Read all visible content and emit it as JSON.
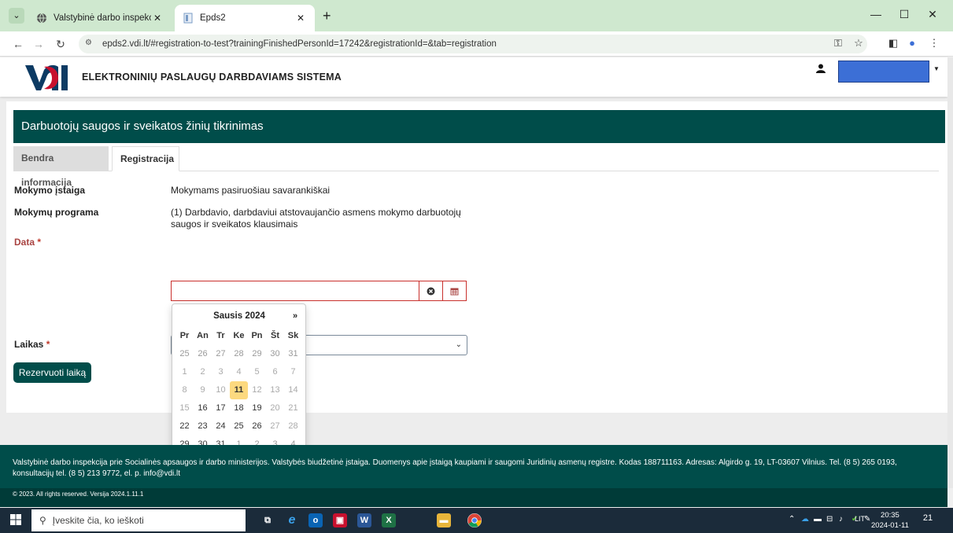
{
  "browser": {
    "tabs": [
      {
        "title": "Valstybinė darbo inspekcija",
        "active": false
      },
      {
        "title": "Epds2",
        "active": true
      }
    ],
    "url": "epds2.vdi.lt/#registration-to-test?trainingFinishedPersonId=17242&registrationId=&tab=registration"
  },
  "header": {
    "system_name": "ELEKTRONINIŲ PASLAUGŲ DARBDAVIAMS SISTEMA"
  },
  "main": {
    "title": "Darbuotojų saugos ir sveikatos žinių tikrinimas",
    "tabs": [
      {
        "label": "Bendra informacija"
      },
      {
        "label": "Registracija"
      }
    ],
    "fields": {
      "institution_label": "Mokymo įstaiga",
      "institution_value": "Mokymams pasiruošiau savarankiškai",
      "program_label": "Mokymų programa",
      "program_value": "(1) Darbdavio, darbdaviui atstovaujančio asmens mokymo darbuotojų saugos ir sveikatos klausimais",
      "date_label": "Data",
      "date_value": "",
      "time_label": "Laikas",
      "required_mark": "*"
    },
    "reserve_button": "Rezervuoti laiką"
  },
  "calendar": {
    "title": "Sausis 2024",
    "next": "»",
    "weekdays": [
      "Pr",
      "An",
      "Tr",
      "Ke",
      "Pn",
      "Št",
      "Sk"
    ],
    "weeks": [
      [
        "25",
        "26",
        "27",
        "28",
        "29",
        "30",
        "31"
      ],
      [
        "1",
        "2",
        "3",
        "4",
        "5",
        "6",
        "7"
      ],
      [
        "8",
        "9",
        "10",
        "11",
        "12",
        "13",
        "14"
      ],
      [
        "15",
        "16",
        "17",
        "18",
        "19",
        "20",
        "21"
      ],
      [
        "22",
        "23",
        "24",
        "25",
        "26",
        "27",
        "28"
      ],
      [
        "29",
        "30",
        "31",
        "1",
        "2",
        "3",
        "4"
      ]
    ],
    "today": "11"
  },
  "footer": {
    "text": "Valstybinė darbo inspekcija prie Socialinės apsaugos ir darbo ministerijos. Valstybės biudžetinė įstaiga. Duomenys apie įstaigą kaupiami ir saugomi Juridinių asmenų registre. Kodas 188711163. Adresas: Algirdo g. 19, LT-03607 Vilnius. Tel. (8 5) 265 0193, konsultacijų tel. (8 5) 213 9772, el. p. info@vdi.lt",
    "copyright": "© 2023. All rights reserved. Versija 2024.1.11.1"
  },
  "taskbar": {
    "search_placeholder": "Įveskite čia, ko ieškoti",
    "language": "LIT",
    "time": "20:35",
    "date": "2024-01-11",
    "notifications": "21"
  },
  "colors": {
    "brand": "#004d4a",
    "error": "#c9302c",
    "today": "#fcd97f"
  }
}
